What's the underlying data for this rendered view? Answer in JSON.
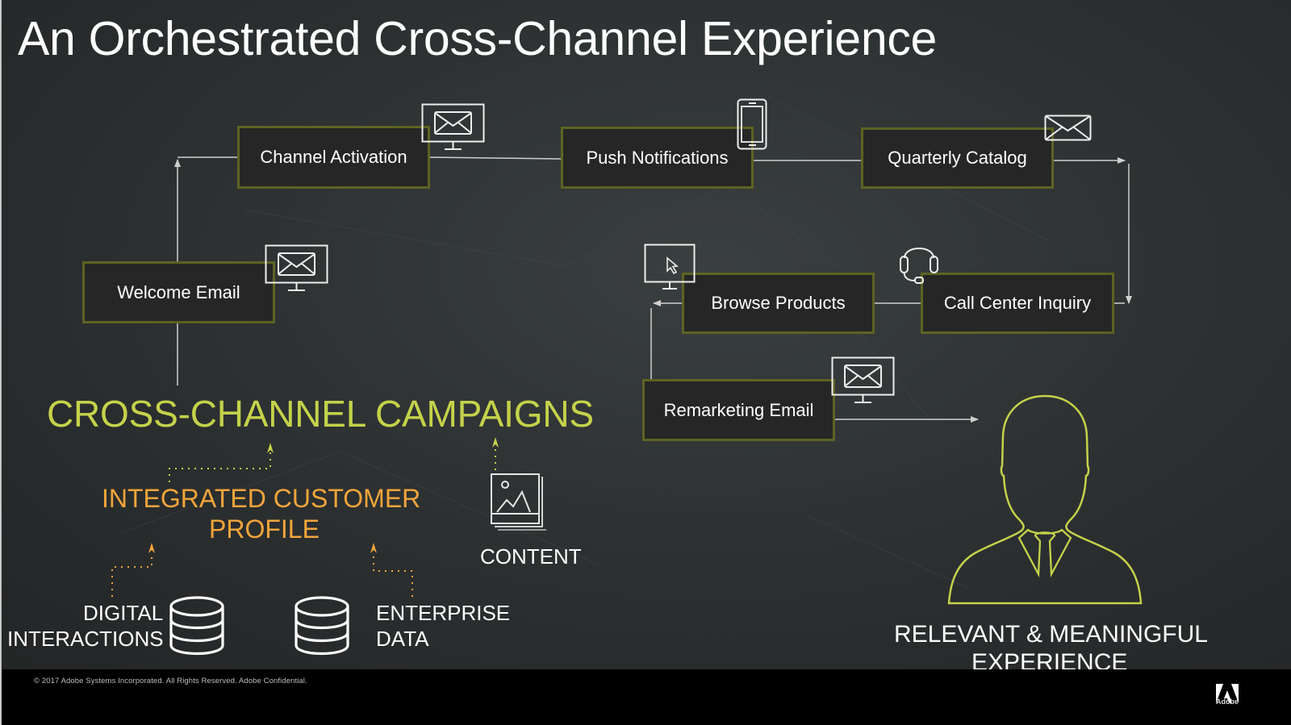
{
  "title": "An Orchestrated Cross-Channel Experience",
  "nodes": {
    "channel_activation": {
      "label": "Channel Activation",
      "icon": "monitor-email-icon"
    },
    "push_notifications": {
      "label": "Push Notifications",
      "icon": "smartphone-icon"
    },
    "quarterly_catalog": {
      "label": "Quarterly Catalog",
      "icon": "envelope-icon"
    },
    "welcome_email": {
      "label": "Welcome Email",
      "icon": "monitor-email-icon"
    },
    "browse_products": {
      "label": "Browse Products",
      "icon": "monitor-cursor-icon"
    },
    "call_center_inquiry": {
      "label": "Call Center Inquiry",
      "icon": "headset-icon"
    },
    "remarketing_email": {
      "label": "Remarketing Email",
      "icon": "monitor-email-icon"
    }
  },
  "flow_order": [
    "Welcome Email",
    "Channel Activation",
    "Push Notifications",
    "Quarterly Catalog",
    "Call Center Inquiry",
    "Browse Products",
    "Remarketing Email",
    "Relevant & Meaningful Experience"
  ],
  "sections": {
    "campaigns": "CROSS-CHANNEL CAMPAIGNS",
    "profile_line1": "INTEGRATED CUSTOMER",
    "profile_line2": "PROFILE",
    "content": "CONTENT",
    "digital_line1": "DIGITAL",
    "digital_line2": "INTERACTIONS",
    "enterprise_line1": "ENTERPRISE",
    "enterprise_line2": "DATA",
    "experience_line1": "RELEVANT & MEANINGFUL",
    "experience_line2": "EXPERIENCE"
  },
  "footer": {
    "copyright": "© 2017 Adobe Systems Incorporated.  All Rights Reserved.  Adobe Confidential.",
    "logo_text": "Adobe"
  },
  "colors": {
    "accent_green": "#c5d24a",
    "accent_orange": "#f2a53a",
    "node_border": "#5e6322",
    "node_fill": "#262626",
    "connector": "#d0d0d0"
  }
}
